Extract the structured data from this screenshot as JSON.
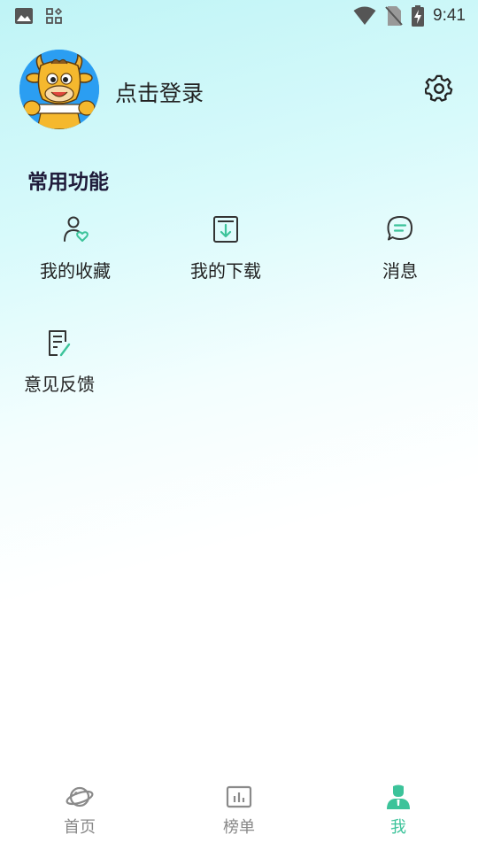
{
  "status_bar": {
    "time": "9:41",
    "icons": [
      "image-notification-icon",
      "apps-notification-icon",
      "wifi-icon",
      "no-sim-icon",
      "battery-charging-icon"
    ]
  },
  "profile": {
    "login_text": "点击登录",
    "avatar": "cartoon-bull-avatar",
    "settings_icon": "gear-icon"
  },
  "common_functions": {
    "title": "常用功能",
    "items": [
      {
        "label": "我的收藏",
        "icon": "user-heart-icon"
      },
      {
        "label": "我的下载",
        "icon": "download-box-icon"
      },
      {
        "label": "消息",
        "icon": "chat-bubble-icon"
      },
      {
        "label": "意见反馈",
        "icon": "feedback-doc-icon"
      }
    ]
  },
  "bottom_nav": {
    "items": [
      {
        "label": "首页",
        "icon": "planet-icon",
        "active": false
      },
      {
        "label": "榜单",
        "icon": "chart-board-icon",
        "active": false
      },
      {
        "label": "我",
        "icon": "person-icon",
        "active": true
      }
    ],
    "active_color": "#3cc39a",
    "inactive_color": "#888888"
  },
  "colors": {
    "accent": "#3cc39a",
    "avatar_bg": "#2b9ef2",
    "title": "#1f1b3a"
  }
}
